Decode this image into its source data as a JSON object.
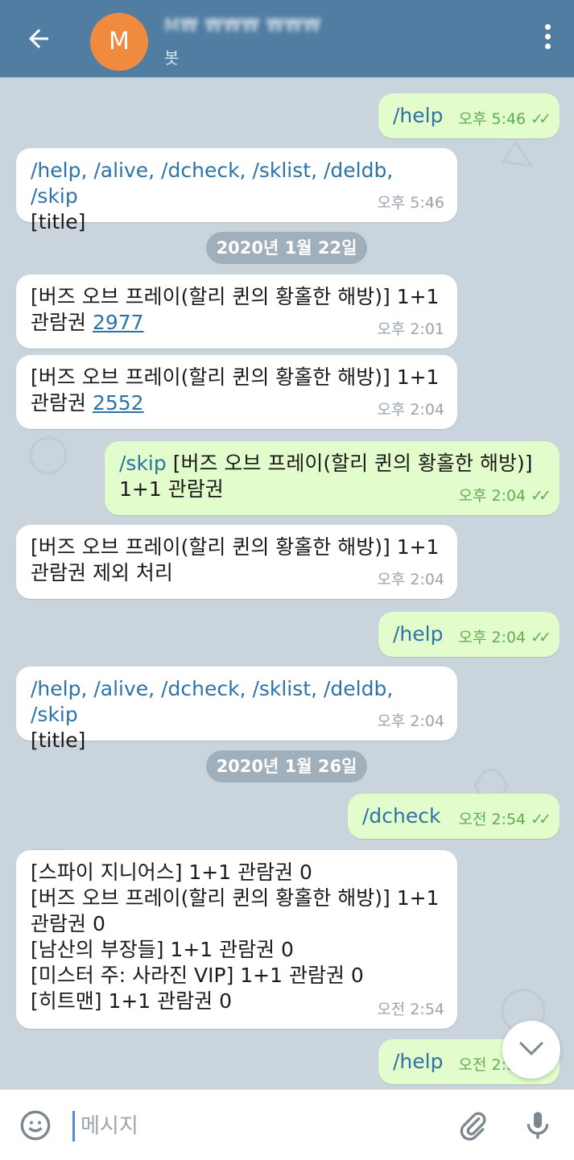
{
  "header": {
    "avatar_letter": "M",
    "title": "M₩ ₩₩₩ ₩₩₩",
    "subtitle": "봇"
  },
  "dates": [
    "2020년 1월 22일",
    "2020년 1월 26일"
  ],
  "messages": [
    {
      "type": "out",
      "text": "/help",
      "time": "오후 5:46",
      "ticks": "✓✓"
    },
    {
      "type": "in",
      "lines": [
        "/help, /alive, /dcheck, /sklist, /deldb, /skip",
        "[title]"
      ],
      "time": "오후 5:46"
    },
    {
      "type": "in",
      "text": "[버즈 오브 프레이(할리 퀸의 황홀한 해방)] 1+1 관람권 ",
      "num": "2977",
      "time": "오후 2:01"
    },
    {
      "type": "in",
      "text": "[버즈 오브 프레이(할리 퀸의 황홀한 해방)] 1+1 관람권 ",
      "num": "2552",
      "time": "오후 2:04"
    },
    {
      "type": "out",
      "cmd": "/skip",
      "text": " [버즈 오브 프레이(할리 퀸의 황홀한 해방)] 1+1 관람권",
      "time": "오후 2:04",
      "ticks": "✓✓"
    },
    {
      "type": "in",
      "text": "[버즈 오브 프레이(할리 퀸의 황홀한 해방)] 1+1 관람권 제외 처리",
      "time": "오후 2:04"
    },
    {
      "type": "out",
      "text": "/help",
      "time": "오후 2:04",
      "ticks": "✓✓"
    },
    {
      "type": "in",
      "lines": [
        "/help, /alive, /dcheck, /sklist, /deldb, /skip",
        "[title]"
      ],
      "time": "오후 2:04"
    },
    {
      "type": "out",
      "text": "/dcheck",
      "time": "오전 2:54",
      "ticks": "✓✓"
    },
    {
      "type": "in",
      "lines": [
        "[스파이 지니어스] 1+1 관람권 0",
        "[버즈 오브 프레이(할리 퀸의 황홀한 해방)] 1+1",
        "관람권 0",
        "[남산의 부장들] 1+1 관람권 0",
        "[미스터 주: 사라진 VIP] 1+1 관람권 0",
        "[히트맨] 1+1 관람권 0"
      ],
      "time": "오전 2:54"
    },
    {
      "type": "out",
      "text": "/help",
      "time": "오전 2:54",
      "ticks": "✓✓"
    }
  ],
  "input": {
    "placeholder": "메시지"
  },
  "icons": {
    "back": "back-arrow-icon",
    "menu": "more-vert-icon",
    "emoji": "emoji-icon",
    "attach": "paperclip-icon",
    "mic": "microphone-icon",
    "scroll": "chevron-down-icon"
  },
  "colors": {
    "header": "#517da2",
    "avatar": "#f08a3e",
    "outgoing": "#e2fccb",
    "incoming": "#ffffff",
    "link": "#2c73a8",
    "check": "#5fae54"
  }
}
